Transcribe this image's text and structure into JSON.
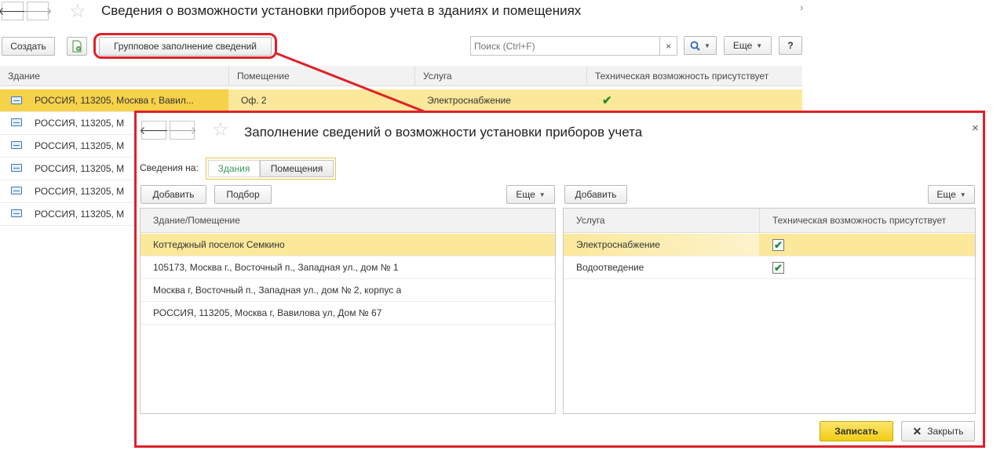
{
  "main": {
    "title": "Сведения о возможности установки приборов учета в зданиях и помещениях",
    "toolbar": {
      "create_label": "Создать",
      "group_fill_label": "Групповое заполнение сведений",
      "search_placeholder": "Поиск (Ctrl+F)",
      "search_clear": "×",
      "more_label": "Еще",
      "help_label": "?"
    },
    "table": {
      "columns": [
        "Здание",
        "Помещение",
        "Услуга",
        "Техническая возможность присутствует"
      ],
      "rows": [
        {
          "building": "РОССИЯ, 113205, Москва г, Вавил...",
          "room": "Оф. 2",
          "service": "Электроснабжение",
          "possible": true
        },
        {
          "building": "РОССИЯ, 113205, М"
        },
        {
          "building": "РОССИЯ, 113205, М"
        },
        {
          "building": "РОССИЯ, 113205, М"
        },
        {
          "building": "РОССИЯ, 113205, М"
        },
        {
          "building": "РОССИЯ, 113205, М"
        }
      ]
    }
  },
  "dialog": {
    "title": "Заполнение сведений о возможности установки приборов учета",
    "close_label": "×",
    "mode_label": "Сведения на:",
    "modes": [
      "Здания",
      "Помещения"
    ],
    "left": {
      "add_label": "Добавить",
      "select_label": "Подбор",
      "more_label": "Еще",
      "column": "Здание/Помещение",
      "rows": [
        "Коттеджный поселок Семкино",
        "105173, Москва г., Восточный п., Западная ул., дом № 1",
        "Москва г, Восточный п., Западная ул., дом № 2, корпус а",
        "РОССИЯ, 113205, Москва г, Вавилова ул, Дом № 67"
      ]
    },
    "right": {
      "add_label": "Добавить",
      "more_label": "Еще",
      "columns": [
        "Услуга",
        "Техническая возможность присутствует"
      ],
      "rows": [
        {
          "service": "Электроснабжение",
          "possible": true
        },
        {
          "service": "Водоотведение",
          "possible": true
        }
      ]
    },
    "save_label": "Записать",
    "close_button_label": "Закрыть"
  },
  "colors": {
    "selection": "#fbe89a",
    "annotation": "#e0202a",
    "primary_button": "#f5d21f",
    "toggle_active_text": "#3a9a5a"
  }
}
